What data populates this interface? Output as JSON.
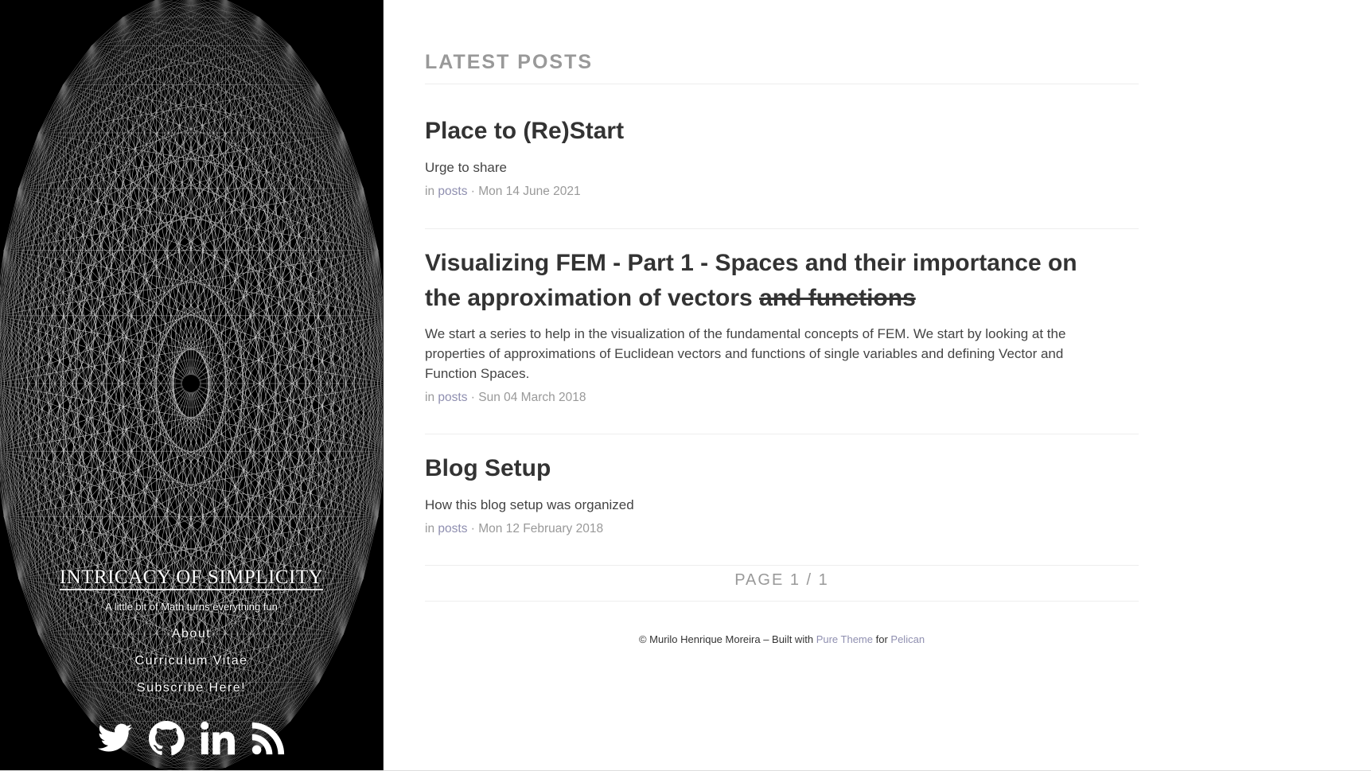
{
  "sidebar": {
    "title": "INTRICACY OF SIMPLICITY",
    "tagline": "A little bit of Math turns everything fun",
    "nav": [
      {
        "label": "About"
      },
      {
        "label": "Curriculum Vitae"
      },
      {
        "label": "Subscribe Here!"
      }
    ],
    "social": [
      "twitter-icon",
      "github-icon",
      "linkedin-icon",
      "rss-icon"
    ]
  },
  "main": {
    "section_title": "LATEST POSTS",
    "posts": [
      {
        "title": "Place to (Re)Start",
        "summary": "Urge to share",
        "meta_prefix": "in",
        "category": "posts",
        "date": "Mon 14 June 2021"
      },
      {
        "title": "Visualizing FEM - Part 1 - Spaces and their importance on the approximation of vectors",
        "title_struck": "and functions",
        "summary": "We start a series to help in the visualization of the fundamental concepts of FEM. We start by looking at the properties of approximations of Euclidean vectors and functions of single variables and defining Vector and Function Spaces.",
        "meta_prefix": "in",
        "category": "posts",
        "date": "Sun 04 March 2018"
      },
      {
        "title": "Blog Setup",
        "summary": "How this blog setup was organized",
        "meta_prefix": "in",
        "category": "posts",
        "date": "Mon 12 February 2018"
      }
    ],
    "pagination": "PAGE 1 / 1",
    "footer": {
      "prefix": "© Murilo Henrique Moreira – Built with",
      "theme_link": "Pure Theme",
      "middle": "for",
      "engine_link": "Pelican"
    }
  },
  "colors": {
    "link": "#8f8fb0",
    "muted": "#999999",
    "text": "#333333",
    "sidebar_bg": "#000000"
  }
}
